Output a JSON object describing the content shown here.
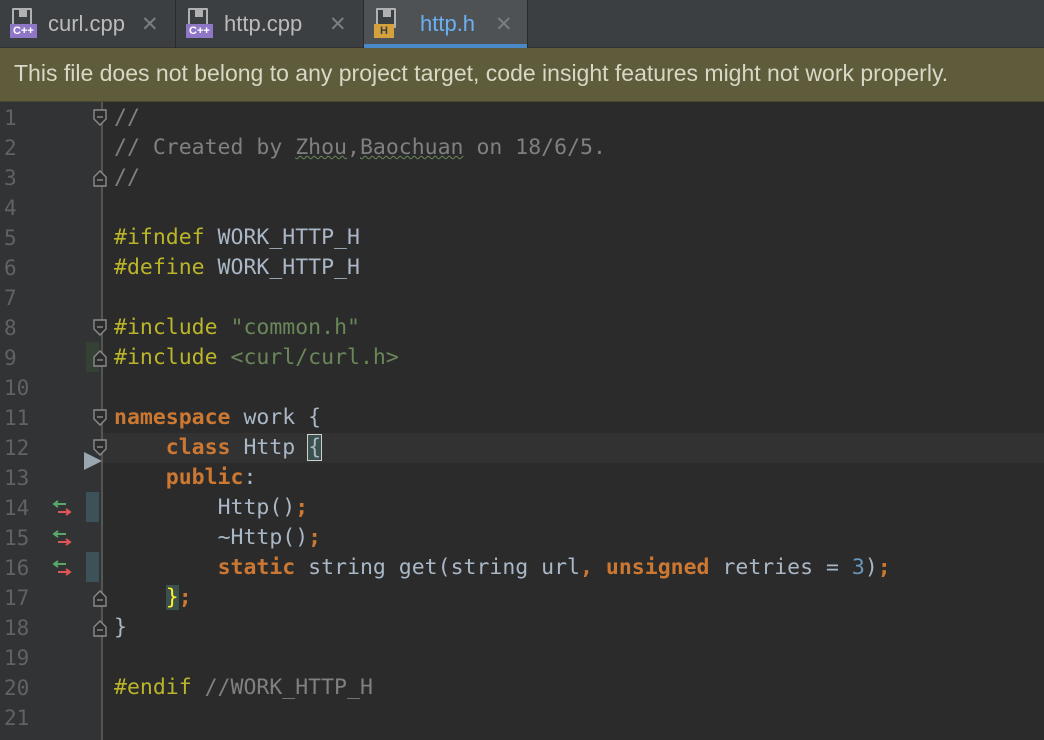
{
  "tabs": [
    {
      "name": "curl.cpp",
      "lang": "C++",
      "active": false
    },
    {
      "name": "http.cpp",
      "lang": "C++",
      "active": false
    },
    {
      "name": "http.h",
      "lang": "H",
      "active": true
    }
  ],
  "close_glyph": "✕",
  "banner": {
    "text": "This file does not belong to any project target, code insight features might not work properly."
  },
  "colors": {
    "keyword": "#cc7832",
    "preprocessor": "#bbb529",
    "string": "#6a8759",
    "comment": "#808080",
    "number": "#6897bb",
    "active_tab_accent": "#4a88c7",
    "banner_bg": "#5e5c3b"
  },
  "editor": {
    "line_numbers": [
      "1",
      "2",
      "3",
      "4",
      "5",
      "6",
      "7",
      "8",
      "9",
      "10",
      "11",
      "12",
      "13",
      "14",
      "15",
      "16",
      "17",
      "18",
      "19",
      "20",
      "21"
    ],
    "code": {
      "l1": "//",
      "l2_pre": "// Created by ",
      "l2_name1": "Zhou",
      "l2_comma": ",",
      "l2_name2": "Baochuan",
      "l2_post": " on 18/6/5.",
      "l3": "//",
      "l5_dir": "#ifndef",
      "l5_rest": " WORK_HTTP_H",
      "l6_dir": "#define",
      "l6_rest": " WORK_HTTP_H",
      "l8_dir": "#include",
      "l8_str": "\"common.h\"",
      "l9_dir": "#include",
      "l9_str": "<curl/curl.h>",
      "l11_kw": "namespace",
      "l11_rest": " work {",
      "l12_indent": "    ",
      "l12_kw": "class",
      "l12_name": " Http ",
      "l12_brace": "{",
      "l13_indent": "    ",
      "l13_kw": "public",
      "l13_colon": ":",
      "l14_indent": "        ",
      "l14_text": "Http()",
      "l14_semi": ";",
      "l15_indent": "        ",
      "l15_text": "~Http()",
      "l15_semi": ";",
      "l16_indent": "        ",
      "l16_kw1": "static",
      "l16_mid1": " string get(string url",
      "l16_comma": ",",
      "l16_space": " ",
      "l16_kw2": "unsigned",
      "l16_mid2": " retries = ",
      "l16_num": "3",
      "l16_paren": ")",
      "l16_semi": ";",
      "l17_indent": "    ",
      "l17_brace": "}",
      "l17_semi": ";",
      "l18": "}",
      "l20_dir": "#endif",
      "l20_cmt": " //WORK_HTTP_H"
    }
  }
}
